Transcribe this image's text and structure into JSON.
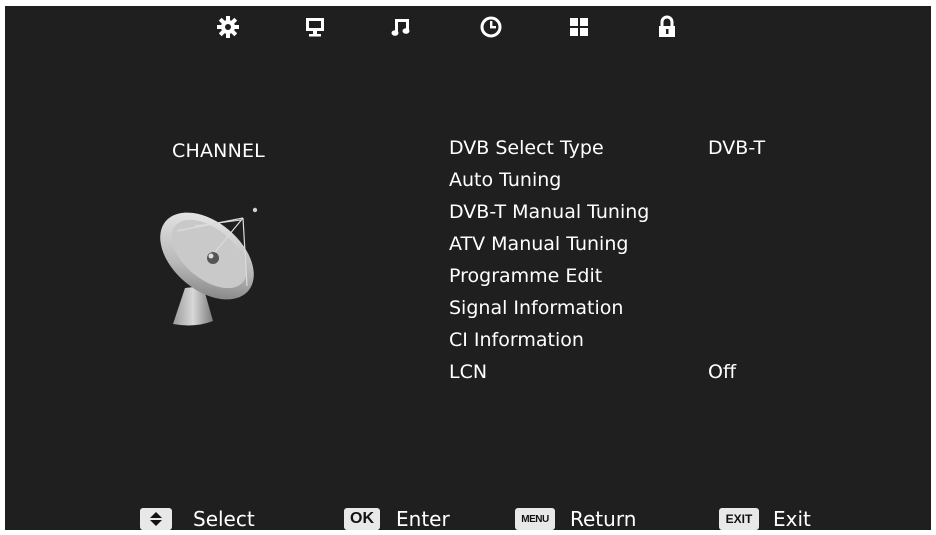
{
  "top_tabs": [
    {
      "icon": "gear-icon"
    },
    {
      "icon": "monitor-icon"
    },
    {
      "icon": "music-icon"
    },
    {
      "icon": "clock-icon"
    },
    {
      "icon": "grid-icon"
    },
    {
      "icon": "lock-icon"
    }
  ],
  "section": {
    "title": "CHANNEL",
    "icon": "satellite-dish-icon"
  },
  "menu": {
    "items": [
      {
        "label": "DVB Select Type",
        "value": "DVB-T"
      },
      {
        "label": "Auto Tuning",
        "value": ""
      },
      {
        "label": "DVB-T Manual Tuning",
        "value": ""
      },
      {
        "label": "ATV Manual Tuning",
        "value": ""
      },
      {
        "label": "Programme Edit",
        "value": ""
      },
      {
        "label": "Signal Information",
        "value": ""
      },
      {
        "label": "CI Information",
        "value": ""
      },
      {
        "label": "LCN",
        "value": "Off"
      }
    ]
  },
  "footer": {
    "select": {
      "key": "updown-icon",
      "label": "Select"
    },
    "enter": {
      "key": "OK",
      "label": "Enter"
    },
    "return": {
      "key": "MENU",
      "label": "Return"
    },
    "exit": {
      "key": "EXIT",
      "label": "Exit"
    }
  },
  "colors": {
    "background": "#1f1f1f",
    "text": "#ffffff",
    "key_badge": "#e8e8e8"
  }
}
